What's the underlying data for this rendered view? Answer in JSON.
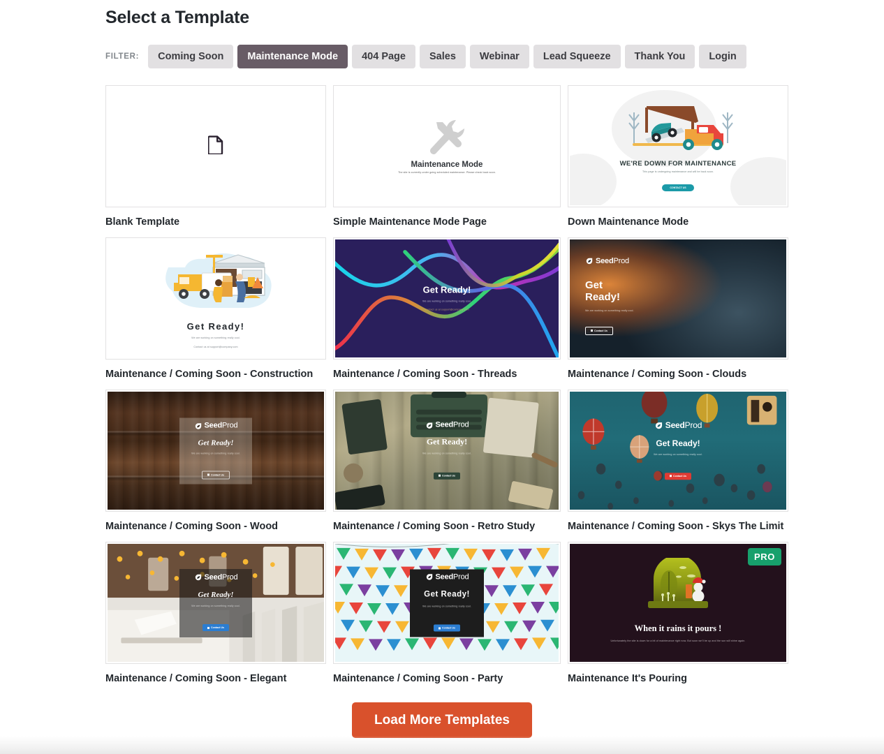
{
  "header": {
    "title": "Select a Template"
  },
  "filter": {
    "label": "FILTER:",
    "active": "Maintenance Mode",
    "active_color": "#685c66",
    "inactive_color": "#e2e0e2",
    "options": [
      "Coming Soon",
      "Maintenance Mode",
      "404 Page",
      "Sales",
      "Webinar",
      "Lead Squeeze",
      "Thank You",
      "Login"
    ]
  },
  "brand": {
    "name_bold": "Seed",
    "name_light": "Prod",
    "logo_icon": "seedprod-leaf-icon"
  },
  "templates": [
    {
      "title": "Blank Template",
      "style": "blank",
      "icon": "document-icon",
      "pro": false
    },
    {
      "title": "Simple Maintenance Mode Page",
      "style": "simple",
      "icon": "wrench-screwdriver-icon",
      "heading": "Maintenance Mode",
      "subtext": "The site is currently under going scheduled maintenance. Please check back soon.",
      "pro": false
    },
    {
      "title": "Down Maintenance Mode",
      "style": "down",
      "icon": "tow-truck-icon",
      "heading": "WE'RE DOWN FOR MAINTENANCE",
      "subtext": "This page is undergoing maintenance and will be back soon.",
      "button": "CONTACT US",
      "button_color": "#1b9aa8",
      "pro": false
    },
    {
      "title": "Maintenance / Coming Soon - Construction",
      "style": "construction",
      "icon": "construction-site-icon",
      "heading": "Get  Ready!",
      "subtext": "We are working on something really cool.",
      "contact_line": "Contact us at support@company.com",
      "pro": false
    },
    {
      "title": "Maintenance / Coming Soon - Threads",
      "style": "threads",
      "heading": "Get Ready!",
      "subtext": "We are working on something really cool.",
      "contact_line": "Contact us at support@company.com",
      "pro": false
    },
    {
      "title": "Maintenance / Coming Soon - Clouds",
      "style": "clouds",
      "heading": "Get Ready!",
      "subtext": "We are working on something really cool.",
      "button": "Contact Us",
      "pro": false
    },
    {
      "title": "Maintenance / Coming Soon - Wood",
      "style": "wood",
      "heading": "Get Ready!",
      "subtext": "We are working on something really cool.",
      "button": "Contact Us",
      "pro": false
    },
    {
      "title": "Maintenance / Coming Soon - Retro Study",
      "style": "retro",
      "heading": "Get Ready!",
      "subtext": "We are working on something really cool.",
      "button": "Contact Us",
      "button_color": "#2c4538",
      "pro": false
    },
    {
      "title": "Maintenance / Coming Soon - Skys The Limit",
      "style": "skys",
      "heading": "Get Ready!",
      "subtext": "We are working on something really cool.",
      "button": "Contact Us",
      "button_color": "#e03b33",
      "pro": false
    },
    {
      "title": "Maintenance / Coming Soon - Elegant",
      "style": "elegant",
      "heading": "Get Ready!",
      "subtext": "We are working on something really cool.",
      "button": "Contact Us",
      "button_color": "#2b7dd1",
      "pro": false
    },
    {
      "title": "Maintenance / Coming Soon - Party",
      "style": "party",
      "heading": "Get Ready!",
      "subtext": "We are working on something really cool.",
      "button": "Contact Us",
      "button_color": "#2b7dd1",
      "pro": false
    },
    {
      "title": "Maintenance It's Pouring",
      "style": "pouring",
      "heading": "When it rains it pours !",
      "subtext": "Unfortunately the site is down for a bit of maintenance right now. But soon we'll be up and the sun will shine again.",
      "pro": true,
      "pro_label": "PRO",
      "pro_color": "#17a06c"
    }
  ],
  "footer": {
    "load_more_label": "Load More Templates",
    "load_more_color": "#d9512c"
  }
}
